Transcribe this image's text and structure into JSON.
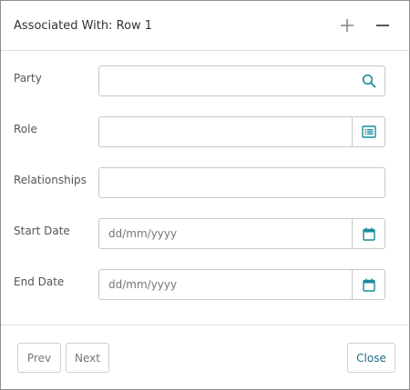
{
  "dialog": {
    "title": "Associated With: Row 1"
  },
  "form": {
    "party": {
      "label": "Party",
      "value": "",
      "placeholder": ""
    },
    "role": {
      "label": "Role",
      "value": "",
      "placeholder": ""
    },
    "relationships": {
      "label": "Relationships",
      "value": "",
      "placeholder": ""
    },
    "start_date": {
      "label": "Start Date",
      "value": "",
      "placeholder": "dd/mm/yyyy"
    },
    "end_date": {
      "label": "End Date",
      "value": "",
      "placeholder": "dd/mm/yyyy"
    }
  },
  "icons": {
    "add": "plus-icon",
    "collapse": "minus-icon",
    "search": "search-icon",
    "list": "list-icon",
    "calendar": "calendar-icon"
  },
  "footer": {
    "prev_label": "Prev",
    "next_label": "Next",
    "close_label": "Close"
  },
  "colors": {
    "accent": "#1b8a9c",
    "header_icon": "#888888",
    "border": "#c8c8c8"
  }
}
